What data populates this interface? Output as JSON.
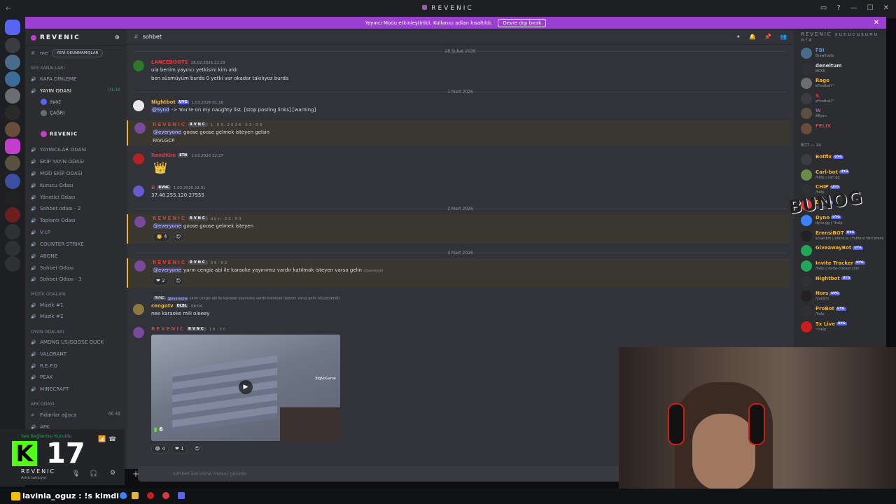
{
  "window": {
    "title": "REVENIC",
    "back": "←",
    "controls": [
      "▭",
      "?",
      "—",
      "☐",
      "✕"
    ]
  },
  "banner": {
    "text": "Yayıncı Modu etkinleştirildi. Kullanıcı adları kısaltıldı.",
    "button": "Devre dışı bırak",
    "close": "✕"
  },
  "server": {
    "name": "REVENIC",
    "new_unreads": "YENİ OKUNMAMIŞLAR",
    "me": "me"
  },
  "channels": [
    {
      "label": "SES KANALLARI",
      "type": "cat"
    },
    {
      "label": "KAFA DİNLEME",
      "type": "voice"
    },
    {
      "label": "YAYIN ODASI",
      "type": "voice",
      "active": true
    },
    {
      "label": "YAYINCILAR ODASI",
      "type": "voice"
    },
    {
      "label": "EKİP YAYIN ODASI",
      "type": "voice"
    },
    {
      "label": "MOD EKİP ODASI",
      "type": "voice"
    },
    {
      "label": "Kurucu Odası",
      "type": "voice"
    },
    {
      "label": "Yönetici Odası",
      "type": "voice"
    },
    {
      "label": "Sohbet odası - 2",
      "type": "voice"
    },
    {
      "label": "Toplantı Odası",
      "type": "voice"
    },
    {
      "label": "V.I.P",
      "type": "voice"
    },
    {
      "label": "COUNTER STRIKE",
      "type": "voice"
    },
    {
      "label": "ABONE",
      "type": "voice"
    },
    {
      "label": "Sohbet Odası",
      "type": "voice"
    },
    {
      "label": "Sohbet Odası - 3",
      "type": "voice"
    },
    {
      "label": "MÜZİK ODALARI",
      "type": "cat"
    },
    {
      "label": "Müzik #1",
      "type": "voice"
    },
    {
      "label": "Müzik #2",
      "type": "voice"
    },
    {
      "label": "OYUN ODALARI",
      "type": "cat"
    },
    {
      "label": "AMONG US/GOOSE DUCK",
      "type": "voice"
    },
    {
      "label": "VALORANT",
      "type": "voice"
    },
    {
      "label": "R.E.P.O",
      "type": "voice"
    },
    {
      "label": "PEAK",
      "type": "voice"
    },
    {
      "label": "MINECRAFT",
      "type": "voice"
    },
    {
      "label": "AFK ODASI",
      "type": "cat"
    },
    {
      "label": "Fidanlar ağaca",
      "type": "text"
    },
    {
      "label": "AFK",
      "type": "voice"
    }
  ],
  "voice_users": [
    {
      "name": "ayaz"
    },
    {
      "name": "ÇAĞRI"
    },
    {
      "name": "REVENIC"
    }
  ],
  "live_time": "01:16",
  "afk_count": "00 43",
  "panel": {
    "voice_status": "Ses Bağlantısı Kuruldu",
    "kick_letter": "K",
    "viewer_count": "17",
    "name": "REVENIC",
    "status": "Artık takılıyor"
  },
  "ticker": {
    "text": "lavinia_oguz : !s kimdi o"
  },
  "chat": {
    "channel": "sohbet",
    "input_placeholder": "sohbet kanalına mesaj gönder",
    "dates": [
      "28 Şubat 2026",
      "1 Mart 2026",
      "2 Mart 2026",
      "3 Mart 2026"
    ],
    "messages": [
      {
        "author": "LANCEBOOTS",
        "time": "28.02.2026 22:29",
        "lines": [
          "ula benim yayıncı yetkisini kim aldı",
          "ben süsmüyüm burda 0 yetki var okadar takılıyoz burda"
        ],
        "color": "#d83c3e"
      },
      {
        "author": "Nightbot",
        "tag": "UYG",
        "time": "1.03.2026 01:18",
        "mention": "@Synd",
        "text": " -> You're on my naughty list. [stop posting links] [warning]",
        "color": "#f0b232"
      },
      {
        "author": "REVENIC",
        "tag": "RVNC",
        "time": "1.03.2026 03:09",
        "mention": "@everyone",
        "text": " goose goose gelmek isteyen gelsin",
        "line2": "PAVLGCP",
        "color": "#d83c3e"
      },
      {
        "author": "RandKim",
        "tag": "ETN",
        "time": "1.03.2026 22:27",
        "color": "#d83c3e"
      },
      {
        "author": "B",
        "tag": "RVNC",
        "time": "1.03.2026 22:31",
        "text": "37.48.255.120:27555",
        "color": "#d83c3e"
      },
      {
        "author": "REVENIC",
        "tag": "RVNC",
        "time": "dün 22:03",
        "mention": "@everyone",
        "text": " goose goose gelmek isteyen",
        "reaction": "4",
        "color": "#d83c3e"
      },
      {
        "author": "REVENIC",
        "tag": "RVNC",
        "time": "06:02",
        "mention": "@everyone",
        "text": " yarın cengiz abi ile karaoke yayınımız vardır katılmak isteyen varsa gelin",
        "edited": "(düzenlendi)",
        "reaction": "2",
        "color": "#d83c3e"
      },
      {
        "author": "cengotv",
        "tag": "DLBL",
        "time": "06:04",
        "reply_tag": "RVNC",
        "reply_mention": "@everyone",
        "reply_text": " yarın cengiz abi ile karaoke yayınımız vardır katılmak isteyen varsa gelin",
        "reply_edited": "(düzenlendi)",
        "text": "nee karaoke mili  oleeey",
        "color": "#f0b232"
      },
      {
        "author": "REVENIC",
        "tag": "RVNC",
        "time": "16:30",
        "video_brand": "BigNoGame",
        "video_count": "6",
        "reactions": [
          "4",
          "1"
        ],
        "color": "#d83c3e"
      }
    ]
  },
  "members": {
    "search_label": "REVENIC sunucusunu ara",
    "bot_category": "BOT — 14",
    "top": [
      {
        "name": "FBI",
        "status": "Brawlhalla"
      },
      {
        "name": "deneltum",
        "status": "BOXR"
      },
      {
        "name": "Rage",
        "status": "eFootball™"
      },
      {
        "name": "S",
        "status": "eFootball™"
      },
      {
        "name": "W",
        "status": "Afiyan"
      },
      {
        "name": "FELIX",
        "status": ""
      }
    ],
    "bots": [
      {
        "name": "Botfix",
        "status": ""
      },
      {
        "name": "Carl-bot",
        "status": "/help | carl.gg"
      },
      {
        "name": "CHIP",
        "status": "/help"
      },
      {
        "name": "DJ",
        "status": "/dhelp"
      },
      {
        "name": "Dyno",
        "status": "dyno.gg | ?help"
      },
      {
        "name": "ErensiBOT",
        "status": "e!yardım | erens.io | Fabfaro Veri erens"
      },
      {
        "name": "GiveawayBot",
        "status": ""
      },
      {
        "name": "Invite Tracker",
        "status": "/help | invite-tracker.com"
      },
      {
        "name": "Nightbot",
        "status": ""
      },
      {
        "name": "Nors",
        "status": "/yardım"
      },
      {
        "name": "ProBot",
        "status": "/help"
      },
      {
        "name": "5x Live",
        "status": "~help"
      }
    ],
    "bot_badge": "UYG"
  },
  "overlay": {
    "text": "BUNOG"
  }
}
